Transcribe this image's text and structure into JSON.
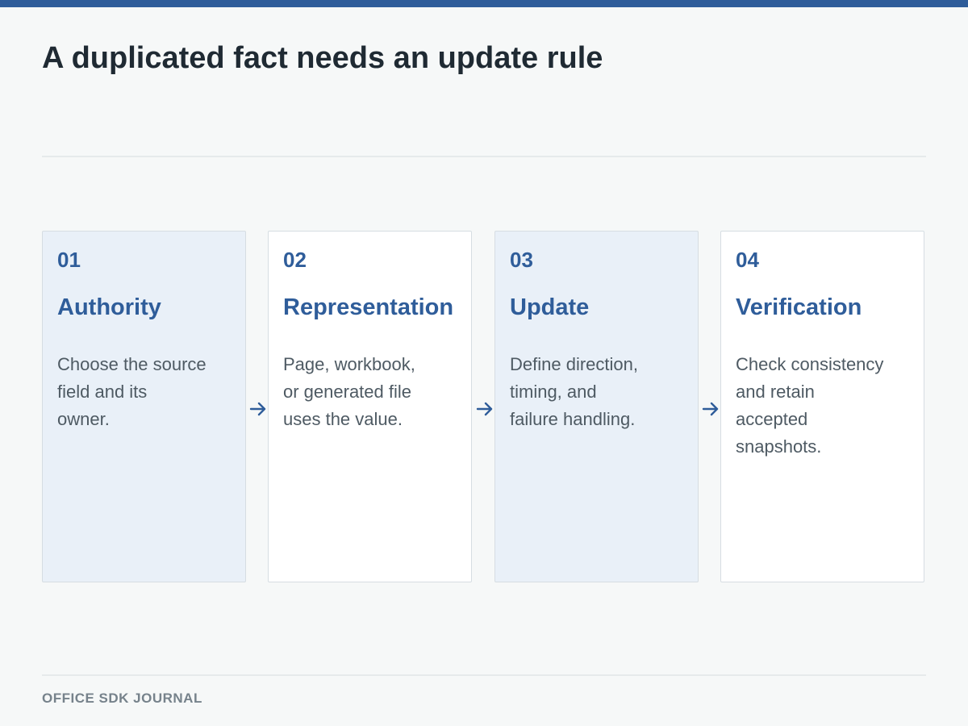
{
  "title": "A duplicated fact needs an update rule",
  "colors": {
    "accent": "#2f5d9a",
    "title_text": "#1f2a33",
    "body_text": "#4e5a63",
    "footer_text": "#76828b",
    "shaded_card": "#e9f0f8",
    "plain_card": "#ffffff",
    "background": "#f6f8f8"
  },
  "steps": [
    {
      "number": "01",
      "title": "Authority",
      "lines": [
        "Choose the source",
        "field and its",
        "owner."
      ]
    },
    {
      "number": "02",
      "title": "Representation",
      "lines": [
        "Page, workbook,",
        "or generated file",
        "uses the value."
      ]
    },
    {
      "number": "03",
      "title": "Update",
      "lines": [
        "Define direction,",
        "timing, and",
        "failure handling."
      ]
    },
    {
      "number": "04",
      "title": "Verification",
      "lines": [
        "Check consistency",
        "and retain",
        "accepted",
        "snapshots."
      ]
    }
  ],
  "arrow_icon": "arrow-right-icon",
  "footer": "OFFICE SDK JOURNAL"
}
